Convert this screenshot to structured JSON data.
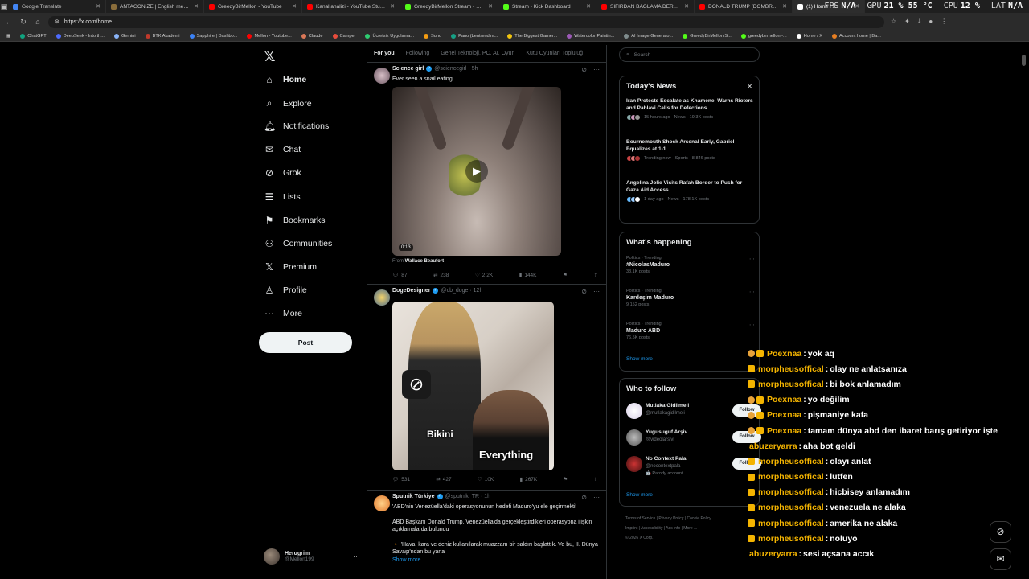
{
  "browser": {
    "tabs": [
      {
        "title": "Google Translate",
        "color": "#4285f4"
      },
      {
        "title": "ANTAGONIZE | English meaning ...",
        "color": "#8a6d3b"
      },
      {
        "title": "GreedyBirMellon - YouTube",
        "color": "#ff0000"
      },
      {
        "title": "Kanal analizi - YouTube Studio",
        "color": "#ff0000"
      },
      {
        "title": "GreedyBirMellon Stream - Watch ...",
        "color": "#53fc18"
      },
      {
        "title": "Stream - Kick Dashboard",
        "color": "#53fc18"
      },
      {
        "title": "SIFIRDAN BAĞLAMA DERSİ 7 ( BU...",
        "color": "#ff0000"
      },
      {
        "title": "DONALD TRUMP (DOMBRA TRAP...",
        "color": "#ff0000"
      },
      {
        "title": "(1) Home / X",
        "color": "#ffffff"
      }
    ],
    "url": "https://x.com/home",
    "stats": [
      {
        "k": "FPS",
        "v": "N/A"
      },
      {
        "k": "GPU",
        "v": "21 % 55 °C"
      },
      {
        "k": "CPU",
        "v": "12 %"
      },
      {
        "k": "LAT",
        "v": "N/A"
      }
    ],
    "bookmarks": [
      {
        "label": "ChatGPT",
        "color": "#10a37f"
      },
      {
        "label": "DeepSeek - Into th...",
        "color": "#4d6bfe"
      },
      {
        "label": "Gemini",
        "color": "#8ab4f8"
      },
      {
        "label": "BTK Akademi",
        "color": "#c0392b"
      },
      {
        "label": "Sapphire | Dashbo...",
        "color": "#3b82f6"
      },
      {
        "label": "Mellon - Youtube...",
        "color": "#ff0000"
      },
      {
        "label": "Claude",
        "color": "#d97757"
      },
      {
        "label": "Camper",
        "color": "#e74c3c"
      },
      {
        "label": "Ücretsiz Uygulama...",
        "color": "#2ecc71"
      },
      {
        "label": "Suno",
        "color": "#f39c12"
      },
      {
        "label": "Pano (bentrendim...",
        "color": "#16a085"
      },
      {
        "label": "The Biggest Gamer...",
        "color": "#f1c40f"
      },
      {
        "label": "Watercolor Paintin...",
        "color": "#9b59b6"
      },
      {
        "label": "AI Image Generato...",
        "color": "#7f8c8d"
      },
      {
        "label": "GreedyBirMellon S...",
        "color": "#53fc18"
      },
      {
        "label": "greedybirmellon -...",
        "color": "#53fc18"
      },
      {
        "label": "Home / X",
        "color": "#ffffff"
      },
      {
        "label": "Account home | Ba...",
        "color": "#e67e22"
      }
    ]
  },
  "nav": {
    "logo": "𝕏",
    "items": [
      {
        "label": "Home",
        "icon": "⌂",
        "name": "home"
      },
      {
        "label": "Explore",
        "icon": "⌕",
        "name": "explore"
      },
      {
        "label": "Notifications",
        "icon": "🔔︎",
        "name": "notifications"
      },
      {
        "label": "Chat",
        "icon": "✉",
        "name": "chat"
      },
      {
        "label": "Grok",
        "icon": "⊘",
        "name": "grok"
      },
      {
        "label": "Lists",
        "icon": "☰",
        "name": "lists"
      },
      {
        "label": "Bookmarks",
        "icon": "⚑",
        "name": "bookmarks"
      },
      {
        "label": "Communities",
        "icon": "⚇",
        "name": "communities"
      },
      {
        "label": "Premium",
        "icon": "𝕏",
        "name": "premium"
      },
      {
        "label": "Profile",
        "icon": "♙",
        "name": "profile"
      },
      {
        "label": "More",
        "icon": "⋯",
        "name": "more"
      }
    ],
    "post_label": "Post",
    "account": {
      "name": "Herugrim",
      "handle": "@Mellon199"
    }
  },
  "feed": {
    "tabs": [
      "For you",
      "Following",
      "Genel Teknoloji, PC, AI, Oyun",
      "Kutu Oyunları Topluluğ"
    ],
    "posts": [
      {
        "name": "Science girl",
        "handle": "@sciencegirl · 5h",
        "text": "Ever seen a snail eating ....",
        "duration": "0:13",
        "from_label": "From",
        "from_name": "Wallace Beaufort",
        "stats": [
          "87",
          "238",
          "2.2K",
          "144K"
        ]
      },
      {
        "name": "DogeDesigner",
        "handle": "@cb_doge · 12h",
        "caption1": "Bikini",
        "caption2": "Everything",
        "stats": [
          "531",
          "427",
          "10K",
          "267K"
        ]
      },
      {
        "name": "Sputnik Türkiye",
        "handle": "@sputnik_TR · 1h",
        "lines": [
          "'ABD'nin Venezüella'daki operasyonunun hedefi Maduro'yu ele geçirmekti'",
          "",
          "ABD Başkanı Donald Trump, Venezüella'da gerçekleştirdikleri operasyona ilişkin açıklamalarda bulundu",
          "",
          "🔸 'Hava, kara ve deniz kullanılarak muazzam bir saldırı başlattık. Ve bu, II. Dünya Savaşı'ndan bu yana"
        ],
        "show_more": "Show more"
      }
    ]
  },
  "right": {
    "search_placeholder": "Search",
    "today_news": {
      "title": "Today's News",
      "items": [
        {
          "headline": "Iran Protests Escalate as Khamenei Warns Rioters and Pahlavi Calls for Defections",
          "meta": "15 hours ago · News · 19.3K posts"
        },
        {
          "headline": "Bournemouth Shock Arsenal Early, Gabriel Equalizes at 1-1",
          "meta": "Trending now · Sports · 8,846 posts"
        },
        {
          "headline": "Angelina Jolie Visits Rafah Border to Push for Gaza Aid Access",
          "meta": "1 day ago · News · 178.1K posts"
        }
      ]
    },
    "happening": {
      "title": "What's happening",
      "items": [
        {
          "context": "Politics · Trending",
          "name": "#NicolasMaduro",
          "posts": "38.1K posts"
        },
        {
          "context": "Politics · Trending",
          "name": "Kardeşim Maduro",
          "posts": "9,152 posts"
        },
        {
          "context": "Politics · Trending",
          "name": "Maduro ABD",
          "posts": "76.5K posts"
        }
      ],
      "show_more": "Show more"
    },
    "who_to_follow": {
      "title": "Who to follow",
      "follow_label": "Follow",
      "items": [
        {
          "name": "Mutlaka Gidilmeli",
          "handle": "@mutlakagidilmeli",
          "sub": ""
        },
        {
          "name": "Yugusuguf Arşiv",
          "handle": "@videolarsivi",
          "sub": ""
        },
        {
          "name": "No Context Pala",
          "handle": "@nocontextpala",
          "sub": "🤖 Parody account"
        }
      ],
      "show_more": "Show more"
    },
    "footer": [
      "Terms of Service",
      "Privacy Policy",
      "Cookie Policy",
      "Imprint",
      "Accessibility",
      "Ads info",
      "More ...",
      "© 2026 X Corp."
    ]
  },
  "chat": [
    {
      "user": "Poexnaa",
      "color": "#f4b400",
      "text": "yok aq",
      "badges": [
        "o",
        "y"
      ]
    },
    {
      "user": "morpheusoffical",
      "color": "#f4b400",
      "text": "olay ne anlatsanıza",
      "badges": [
        "y"
      ]
    },
    {
      "user": "morpheusoffical",
      "color": "#f4b400",
      "text": "bi bok anlamadım",
      "badges": [
        "y"
      ]
    },
    {
      "user": "Poexnaa",
      "color": "#f4b400",
      "text": "yo değilim",
      "badges": [
        "o",
        "y"
      ]
    },
    {
      "user": "Poexnaa",
      "color": "#f4b400",
      "text": "pişmaniye kafa",
      "badges": [
        "o",
        "y"
      ]
    },
    {
      "user": "Poexnaa",
      "color": "#f4b400",
      "text": "tamam dünya abd den ibaret barış getiriyor işte",
      "badges": [
        "o",
        "y"
      ]
    },
    {
      "user": "abuzeryarra",
      "color": "#f4b400",
      "text": "aha bot geldi",
      "badges": []
    },
    {
      "user": "morpheusoffical",
      "color": "#f4b400",
      "text": "olayı anlat",
      "badges": [
        "y"
      ]
    },
    {
      "user": "morpheusoffical",
      "color": "#f4b400",
      "text": "lutfen",
      "badges": [
        "y"
      ]
    },
    {
      "user": "morpheusoffical",
      "color": "#f4b400",
      "text": "hicbisey anlamadım",
      "badges": [
        "y"
      ]
    },
    {
      "user": "morpheusoffical",
      "color": "#f4b400",
      "text": "venezuela ne alaka",
      "badges": [
        "y"
      ]
    },
    {
      "user": "morpheusoffical",
      "color": "#f4b400",
      "text": "amerika ne alaka",
      "badges": [
        "y"
      ]
    },
    {
      "user": "morpheusoffical",
      "color": "#f4b400",
      "text": "noluyo",
      "badges": [
        "y"
      ]
    },
    {
      "user": "abuzeryarra",
      "color": "#f4b400",
      "text": "sesi açsana accık",
      "badges": []
    }
  ],
  "floating": [
    {
      "icon": "⊘",
      "name": "grok-float-icon"
    },
    {
      "icon": "✉",
      "name": "messages-float-icon"
    }
  ]
}
